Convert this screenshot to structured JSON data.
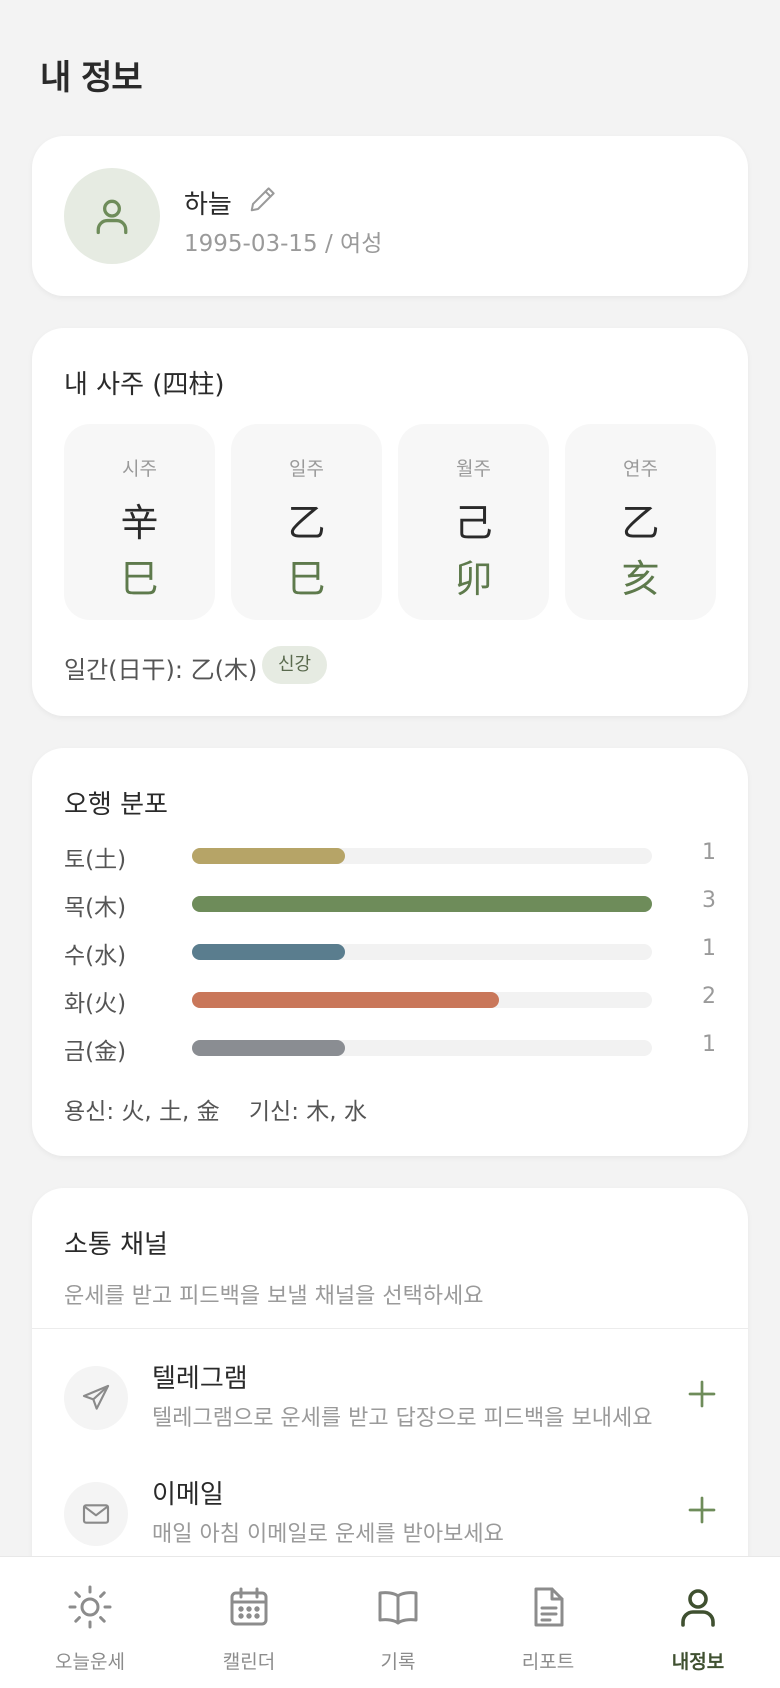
{
  "page": {
    "title": "내 정보"
  },
  "profile": {
    "name": "하늘",
    "meta": "1995-03-15 / 여성"
  },
  "saju": {
    "title": "내 사주 (四柱)",
    "pillars": [
      {
        "label": "시주",
        "stem": "辛",
        "branch": "巳"
      },
      {
        "label": "일주",
        "stem": "乙",
        "branch": "巳"
      },
      {
        "label": "월주",
        "stem": "己",
        "branch": "卯"
      },
      {
        "label": "연주",
        "stem": "乙",
        "branch": "亥"
      }
    ],
    "daymaster": "일간(日干): 乙(木)",
    "badge": "신강"
  },
  "elements": {
    "title": "오행 분포",
    "max": 3,
    "items": [
      {
        "label": "토(土)",
        "count": "1",
        "value": 1,
        "color": "#b6a467"
      },
      {
        "label": "목(木)",
        "count": "3",
        "value": 3,
        "color": "#6e8c5a"
      },
      {
        "label": "수(水)",
        "count": "1",
        "value": 1,
        "color": "#5a7d8e"
      },
      {
        "label": "화(火)",
        "count": "2",
        "value": 2,
        "color": "#c9775a"
      },
      {
        "label": "금(金)",
        "count": "1",
        "value": 1,
        "color": "#8a8d92"
      }
    ],
    "yongsin": "용신: 火, 土, 金    기신: 木, 水"
  },
  "channels": {
    "title": "소통 채널",
    "subtitle": "운세를 받고 피드백을 보낼 채널을 선택하세요",
    "items": [
      {
        "title": "텔레그램",
        "desc": "텔레그램으로 운세를 받고 답장으로 피드백을 보내세요",
        "icon": "send-icon"
      },
      {
        "title": "이메일",
        "desc": "매일 아침 이메일로 운세를 받아보세요",
        "icon": "mail-icon"
      }
    ]
  },
  "nav": {
    "items": [
      {
        "label": "오늘운세",
        "icon": "sun-icon"
      },
      {
        "label": "캘린더",
        "icon": "calendar-icon"
      },
      {
        "label": "기록",
        "icon": "book-icon"
      },
      {
        "label": "리포트",
        "icon": "document-icon"
      },
      {
        "label": "내정보",
        "icon": "user-icon",
        "active": true
      }
    ]
  },
  "colors": {
    "accent": "#5e7a4c",
    "background": "#f3f3f3"
  }
}
